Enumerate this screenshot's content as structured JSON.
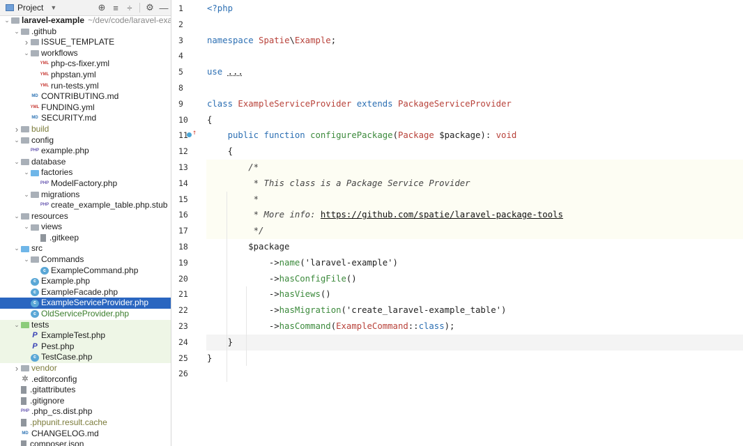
{
  "sidebar": {
    "header": {
      "title": "Project",
      "tools": [
        "locate-icon",
        "expand-all-icon",
        "collapse-all-icon",
        "gear-icon",
        "minimize-icon"
      ]
    },
    "tree": [
      {
        "depth": 0,
        "arrow": "open",
        "icon": "folder",
        "name": "laravel-example",
        "bold": true,
        "path": "~/dev/code/laravel-exar"
      },
      {
        "depth": 1,
        "arrow": "open",
        "icon": "folder",
        "name": ".github"
      },
      {
        "depth": 2,
        "arrow": "closed",
        "icon": "folder",
        "name": "ISSUE_TEMPLATE"
      },
      {
        "depth": 2,
        "arrow": "open",
        "icon": "folder",
        "name": "workflows"
      },
      {
        "depth": 3,
        "arrow": "",
        "icon": "yml",
        "name": "php-cs-fixer.yml"
      },
      {
        "depth": 3,
        "arrow": "",
        "icon": "yml",
        "name": "phpstan.yml"
      },
      {
        "depth": 3,
        "arrow": "",
        "icon": "yml",
        "name": "run-tests.yml"
      },
      {
        "depth": 2,
        "arrow": "",
        "icon": "md",
        "name": "CONTRIBUTING.md"
      },
      {
        "depth": 2,
        "arrow": "",
        "icon": "yml",
        "name": "FUNDING.yml"
      },
      {
        "depth": 2,
        "arrow": "",
        "icon": "md",
        "name": "SECURITY.md"
      },
      {
        "depth": 1,
        "arrow": "closed",
        "icon": "folder",
        "name": "build",
        "color": "olive"
      },
      {
        "depth": 1,
        "arrow": "open",
        "icon": "folder",
        "name": "config"
      },
      {
        "depth": 2,
        "arrow": "",
        "icon": "php",
        "name": "example.php"
      },
      {
        "depth": 1,
        "arrow": "open",
        "icon": "folder",
        "name": "database"
      },
      {
        "depth": 2,
        "arrow": "open",
        "icon": "folder-blue",
        "name": "factories"
      },
      {
        "depth": 3,
        "arrow": "",
        "icon": "php",
        "name": "ModelFactory.php"
      },
      {
        "depth": 2,
        "arrow": "open",
        "icon": "folder",
        "name": "migrations"
      },
      {
        "depth": 3,
        "arrow": "",
        "icon": "php",
        "name": "create_example_table.php.stub"
      },
      {
        "depth": 1,
        "arrow": "open",
        "icon": "folder",
        "name": "resources"
      },
      {
        "depth": 2,
        "arrow": "open",
        "icon": "folder",
        "name": "views"
      },
      {
        "depth": 3,
        "arrow": "",
        "icon": "txt",
        "name": ".gitkeep"
      },
      {
        "depth": 1,
        "arrow": "open",
        "icon": "folder-blue",
        "name": "src"
      },
      {
        "depth": 2,
        "arrow": "open",
        "icon": "folder",
        "name": "Commands"
      },
      {
        "depth": 3,
        "arrow": "",
        "icon": "cls",
        "name": "ExampleCommand.php"
      },
      {
        "depth": 2,
        "arrow": "",
        "icon": "cls",
        "name": "Example.php"
      },
      {
        "depth": 2,
        "arrow": "",
        "icon": "cls",
        "name": "ExampleFacade.php"
      },
      {
        "depth": 2,
        "arrow": "",
        "icon": "cls",
        "name": "ExampleServiceProvider.php",
        "selected": true
      },
      {
        "depth": 2,
        "arrow": "",
        "icon": "cls",
        "name": "OldServiceProvider.php",
        "color": "green"
      },
      {
        "depth": 1,
        "arrow": "open",
        "icon": "folder-green",
        "name": "tests",
        "testbg": true
      },
      {
        "depth": 2,
        "arrow": "",
        "icon": "pest",
        "name": "ExampleTest.php",
        "testbg": true
      },
      {
        "depth": 2,
        "arrow": "",
        "icon": "pest",
        "name": "Pest.php",
        "testbg": true
      },
      {
        "depth": 2,
        "arrow": "",
        "icon": "cls",
        "name": "TestCase.php",
        "testbg": true
      },
      {
        "depth": 1,
        "arrow": "closed",
        "icon": "folder",
        "name": "vendor",
        "color": "olive"
      },
      {
        "depth": 1,
        "arrow": "",
        "icon": "gear",
        "name": ".editorconfig"
      },
      {
        "depth": 1,
        "arrow": "",
        "icon": "txt",
        "name": ".gitattributes"
      },
      {
        "depth": 1,
        "arrow": "",
        "icon": "txt",
        "name": ".gitignore"
      },
      {
        "depth": 1,
        "arrow": "",
        "icon": "php",
        "name": ".php_cs.dist.php"
      },
      {
        "depth": 1,
        "arrow": "",
        "icon": "txt",
        "name": ".phpunit.result.cache",
        "color": "olive"
      },
      {
        "depth": 1,
        "arrow": "",
        "icon": "md",
        "name": "CHANGELOG.md"
      },
      {
        "depth": 1,
        "arrow": "",
        "icon": "txt",
        "name": "composer.json"
      }
    ]
  },
  "editor": {
    "lines": [
      {
        "n": "1",
        "tokens": [
          [
            "kw",
            "<?php"
          ]
        ]
      },
      {
        "n": "2",
        "tokens": []
      },
      {
        "n": "3",
        "tokens": [
          [
            "kw",
            "namespace "
          ],
          [
            "cls",
            "Spatie"
          ],
          [
            "plain",
            "\\"
          ],
          [
            "cls",
            "Example"
          ],
          [
            "plain",
            ";"
          ]
        ]
      },
      {
        "n": "4",
        "tokens": []
      },
      {
        "n": "5",
        "tokens": [
          [
            "kw",
            "use "
          ],
          [
            "dots",
            "..."
          ]
        ]
      },
      {
        "n": "8",
        "tokens": []
      },
      {
        "n": "9",
        "tokens": [
          [
            "kw",
            "class "
          ],
          [
            "cls",
            "ExampleServiceProvider "
          ],
          [
            "kw",
            "extends "
          ],
          [
            "cls",
            "PackageServiceProvider"
          ]
        ]
      },
      {
        "n": "10",
        "tokens": [
          [
            "plain",
            "{"
          ]
        ]
      },
      {
        "n": "11",
        "marker": true,
        "tokens": [
          [
            "plain",
            "    "
          ],
          [
            "kw",
            "public function "
          ],
          [
            "fn",
            "configurePackage"
          ],
          [
            "plain",
            "("
          ],
          [
            "cls",
            "Package "
          ],
          [
            "plain",
            "$package): "
          ],
          [
            "cls",
            "void"
          ]
        ]
      },
      {
        "n": "12",
        "tokens": [
          [
            "plain",
            "    {"
          ]
        ]
      },
      {
        "n": "13",
        "comment": true,
        "tokens": [
          [
            "plain",
            "        "
          ],
          [
            "cm",
            "/*"
          ]
        ]
      },
      {
        "n": "14",
        "comment": true,
        "tokens": [
          [
            "plain",
            "         "
          ],
          [
            "cm",
            "* This class is a Package Service Provider"
          ]
        ]
      },
      {
        "n": "15",
        "comment": true,
        "tokens": [
          [
            "plain",
            "         "
          ],
          [
            "cm",
            "*"
          ]
        ]
      },
      {
        "n": "16",
        "comment": true,
        "tokens": [
          [
            "plain",
            "         "
          ],
          [
            "cm",
            "* More info: "
          ],
          [
            "link",
            "https://github.com/spatie/laravel-package-tools"
          ]
        ]
      },
      {
        "n": "17",
        "comment": true,
        "tokens": [
          [
            "plain",
            "         "
          ],
          [
            "cm",
            "*/"
          ]
        ]
      },
      {
        "n": "18",
        "tokens": [
          [
            "plain",
            "        $package"
          ]
        ]
      },
      {
        "n": "19",
        "tokens": [
          [
            "plain",
            "            ->"
          ],
          [
            "fn",
            "name"
          ],
          [
            "plain",
            "('laravel-example')"
          ]
        ]
      },
      {
        "n": "20",
        "tokens": [
          [
            "plain",
            "            ->"
          ],
          [
            "fn",
            "hasConfigFile"
          ],
          [
            "plain",
            "()"
          ]
        ]
      },
      {
        "n": "21",
        "tokens": [
          [
            "plain",
            "            ->"
          ],
          [
            "fn",
            "hasViews"
          ],
          [
            "plain",
            "()"
          ]
        ]
      },
      {
        "n": "22",
        "tokens": [
          [
            "plain",
            "            ->"
          ],
          [
            "fn",
            "hasMigration"
          ],
          [
            "plain",
            "('create_laravel-example_table')"
          ]
        ]
      },
      {
        "n": "23",
        "tokens": [
          [
            "plain",
            "            ->"
          ],
          [
            "fn",
            "hasCommand"
          ],
          [
            "plain",
            "("
          ],
          [
            "cls",
            "ExampleCommand"
          ],
          [
            "plain",
            "::"
          ],
          [
            "kw",
            "class"
          ],
          [
            "plain",
            ");"
          ]
        ]
      },
      {
        "n": "24",
        "current": true,
        "tokens": [
          [
            "plain",
            "    }"
          ]
        ]
      },
      {
        "n": "25",
        "tokens": [
          [
            "plain",
            "}"
          ]
        ]
      },
      {
        "n": "26",
        "tokens": []
      }
    ]
  }
}
